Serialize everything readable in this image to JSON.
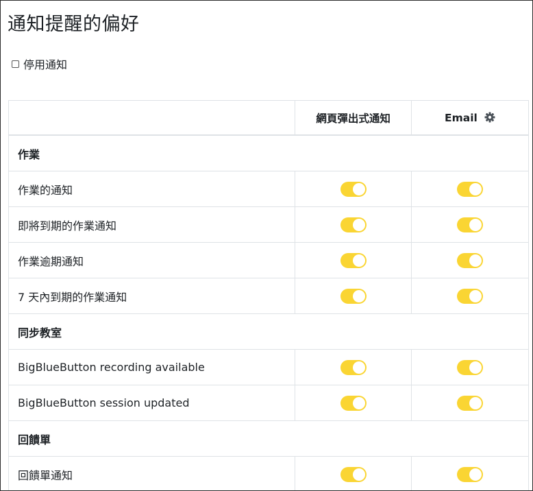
{
  "page": {
    "title": "通知提醒的偏好",
    "disable_label": "停用通知"
  },
  "table": {
    "headers": [
      "",
      "網頁彈出式通知",
      "Email"
    ],
    "sections": [
      {
        "title": "作業",
        "rows": [
          {
            "label": "作業的通知",
            "web": true,
            "email": true
          },
          {
            "label": "即將到期的作業通知",
            "web": true,
            "email": true
          },
          {
            "label": "作業逾期通知",
            "web": true,
            "email": true
          },
          {
            "label": "7 天內到期的作業通知",
            "web": true,
            "email": true
          }
        ]
      },
      {
        "title": "同步教室",
        "rows": [
          {
            "label": "BigBlueButton recording available",
            "web": true,
            "email": true
          },
          {
            "label": "BigBlueButton session updated",
            "web": true,
            "email": true
          }
        ]
      },
      {
        "title": "回饋單",
        "rows": [
          {
            "label": "回饋單通知",
            "web": true,
            "email": true
          }
        ]
      }
    ]
  },
  "icons": {
    "email_settings": "gear-icon"
  },
  "colors": {
    "toggle_on": "#fad533",
    "border": "#dee2e6",
    "text": "#1d2125"
  }
}
